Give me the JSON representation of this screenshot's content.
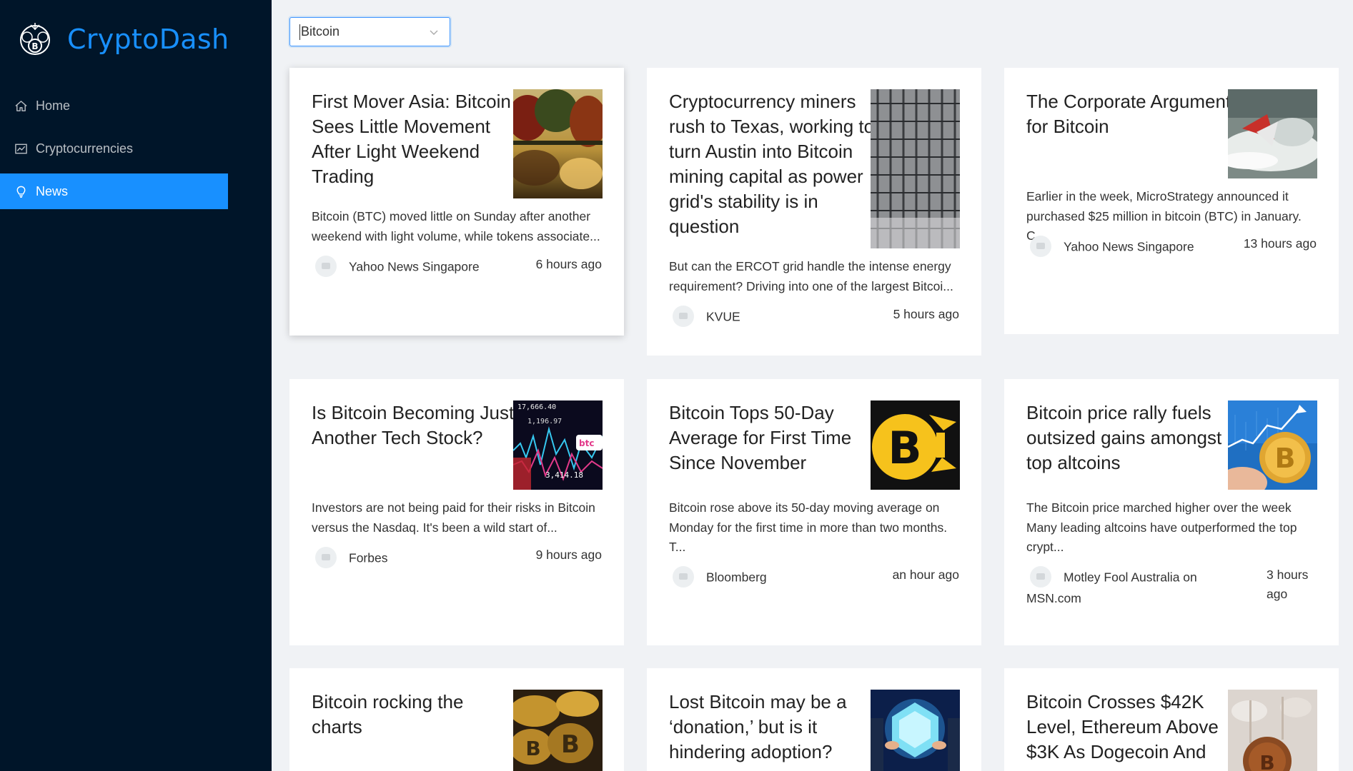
{
  "app": {
    "name": "CryptoDash"
  },
  "sidebar": {
    "items": [
      {
        "label": "Home",
        "icon": "home-icon"
      },
      {
        "label": "Cryptocurrencies",
        "icon": "chart-icon"
      },
      {
        "label": "News",
        "icon": "bulb-icon",
        "active": true
      }
    ]
  },
  "filter": {
    "value": "Bitcoin"
  },
  "news": [
    {
      "title": "First Mover Asia: Bitcoin Sees Little Movement After Light Weekend Trading",
      "description": "Bitcoin (BTC) moved little on Sunday after another weekend with light volume, while tokens associate...",
      "provider": "Yahoo News Singapore",
      "time": "6 hours ago"
    },
    {
      "title": "Cryptocurrency miners rush to Texas, working to turn Austin into Bitcoin mining capital as power grid's stability is in question",
      "description": "But can the ERCOT grid handle the intense energy requirement? Driving into one of the largest Bitcoi...",
      "provider": "KVUE",
      "time": "5 hours ago"
    },
    {
      "title": "The Corporate Argument for Bitcoin",
      "description": "Earlier in the week, MicroStrategy announced it purchased $25 million in bitcoin (BTC) in January. C...",
      "provider": "Yahoo News Singapore",
      "time": "13 hours ago"
    },
    {
      "title": "Is Bitcoin Becoming Just Another Tech Stock?",
      "description": "Investors are not being paid for their risks in Bitcoin versus the Nasdaq. It's been a wild start of...",
      "provider": "Forbes",
      "time": "9 hours ago"
    },
    {
      "title": "Bitcoin Tops 50-Day Average for First Time Since November",
      "description": "Bitcoin rose above its 50-day moving average on Monday for the first time in more than two months. T...",
      "provider": "Bloomberg",
      "time": "an hour ago"
    },
    {
      "title": "Bitcoin price rally fuels outsized gains amongst top altcoins",
      "description": "The Bitcoin price marched higher over the week Many leading altcoins have outperformed the top crypt...",
      "provider": "Motley Fool Australia on MSN.com",
      "time": "3 hours ago"
    },
    {
      "title": "Bitcoin rocking the charts"
    },
    {
      "title": "Lost Bitcoin may be a ‘donation,’ but is it hindering adoption?"
    },
    {
      "title": "Bitcoin Crosses $42K Level, Ethereum Above $3K As Dogecoin And"
    }
  ]
}
